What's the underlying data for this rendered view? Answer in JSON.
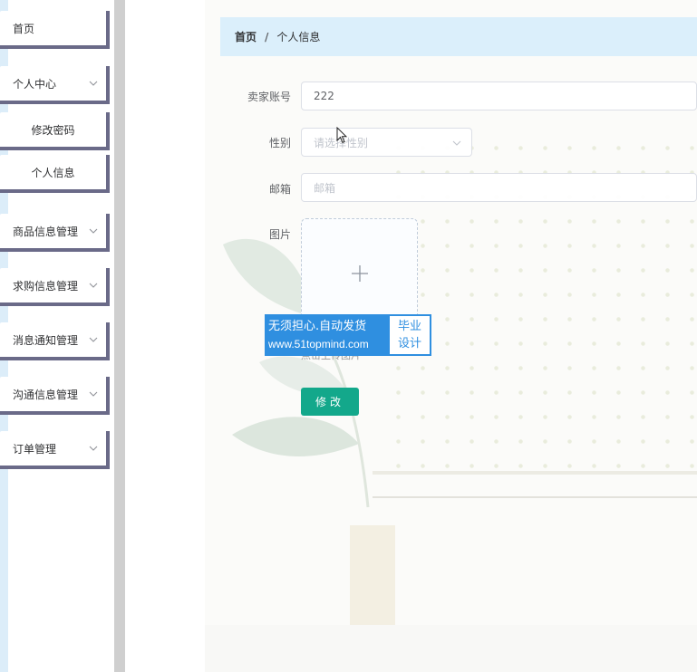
{
  "sidebar": {
    "items": [
      {
        "label": "首页",
        "expandable": false
      },
      {
        "label": "个人中心",
        "expandable": true
      },
      {
        "label": "修改密码",
        "expandable": false
      },
      {
        "label": "个人信息",
        "expandable": false
      },
      {
        "label": "商品信息管理",
        "expandable": true
      },
      {
        "label": "求购信息管理",
        "expandable": true
      },
      {
        "label": "消息通知管理",
        "expandable": true
      },
      {
        "label": "沟通信息管理",
        "expandable": true
      },
      {
        "label": "订单管理",
        "expandable": true
      }
    ]
  },
  "breadcrumb": {
    "home": "首页",
    "separator": "/",
    "current": "个人信息"
  },
  "form": {
    "account_label": "卖家账号",
    "account_value": "222",
    "gender_label": "性别",
    "gender_placeholder": "请选择性别",
    "email_label": "邮箱",
    "email_placeholder": "邮箱",
    "image_label": "图片",
    "upload_tip": "点击上传图片",
    "submit_label": "修改"
  },
  "watermark": {
    "line1": "无须担心.自动发货",
    "line2": "www.51topmind.com",
    "badge_line1": "毕业",
    "badge_line2": "设计"
  },
  "colors": {
    "accent": "#13a88b",
    "breadcrumb_bg": "#dbeffb",
    "sidebar_border": "#6a6a88",
    "watermark_blue": "#2f8fe0"
  }
}
